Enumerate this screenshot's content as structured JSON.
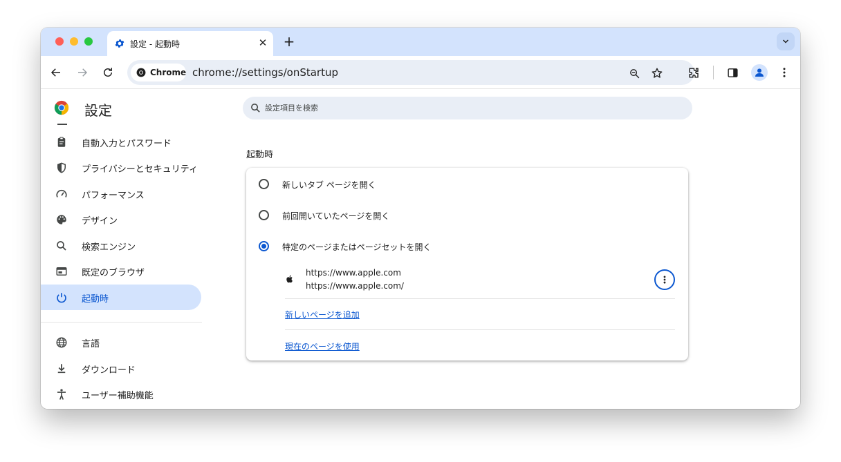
{
  "tab": {
    "title": "設定 - 起動時",
    "close_symbol": "✕",
    "new_tab_symbol": "+"
  },
  "omnibox": {
    "chip_label": "Chrome",
    "url": "chrome://settings/onStartup"
  },
  "page": {
    "title": "設定"
  },
  "search": {
    "placeholder": "設定項目を検索"
  },
  "sidebar": {
    "items": [
      {
        "label": "自動入力とパスワード",
        "icon": "clipboard-icon",
        "active": false
      },
      {
        "label": "プライバシーとセキュリティ",
        "icon": "shield-icon",
        "active": false
      },
      {
        "label": "パフォーマンス",
        "icon": "speedometer-icon",
        "active": false
      },
      {
        "label": "デザイン",
        "icon": "palette-icon",
        "active": false
      },
      {
        "label": "検索エンジン",
        "icon": "search-icon",
        "active": false
      },
      {
        "label": "既定のブラウザ",
        "icon": "browser-window-icon",
        "active": false
      },
      {
        "label": "起動時",
        "icon": "power-icon",
        "active": true
      },
      {
        "label": "言語",
        "icon": "globe-icon",
        "active": false
      },
      {
        "label": "ダウンロード",
        "icon": "download-icon",
        "active": false
      },
      {
        "label": "ユーザー補助機能",
        "icon": "accessibility-icon",
        "active": false
      }
    ]
  },
  "startup": {
    "section_title": "起動時",
    "options": [
      {
        "label": "新しいタブ ページを開く",
        "checked": false
      },
      {
        "label": "前回開いていたページを開く",
        "checked": false
      },
      {
        "label": "特定のページまたはページセットを開く",
        "checked": true
      }
    ],
    "page": {
      "title": "https://www.apple.com",
      "url": "https://www.apple.com/",
      "icon": "apple-icon"
    },
    "add_page_link": "新しいページを追加",
    "use_current_link": "現在のページを使用"
  },
  "colors": {
    "accent": "#0b57d0",
    "tabstrip": "#d3e3fd",
    "active_nav": "#d3e3fd",
    "omnibox": "#e9eef6"
  }
}
